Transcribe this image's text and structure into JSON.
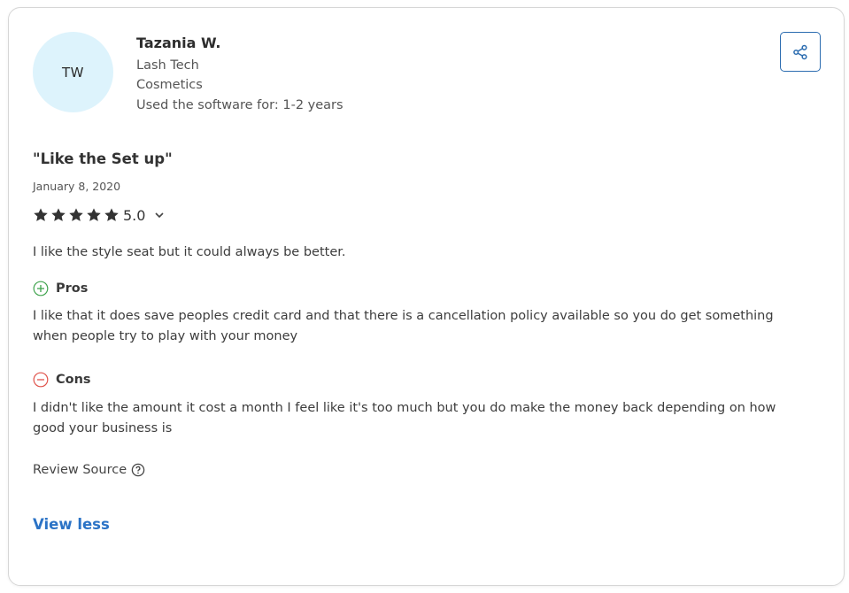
{
  "reviewer": {
    "initials": "TW",
    "name": "Tazania W.",
    "role": "Lash Tech",
    "industry": "Cosmetics",
    "usage": "Used the software for: 1-2 years"
  },
  "review": {
    "title": "\"Like the Set up\"",
    "date": "January 8, 2020",
    "rating": "5.0",
    "stars": 5,
    "summary": "I like the style seat but it could always be better.",
    "pros_label": "Pros",
    "pros_text": "I like that it does save peoples credit card and that there is a cancellation policy available so you do get something when people try to play with your money",
    "cons_label": "Cons",
    "cons_text": "I didn't like the amount it cost a month I feel like it's too much but you do make the money back depending on how good your business is",
    "source_label": "Review Source",
    "view_less": "View less"
  },
  "icons": {
    "share": "share-icon",
    "star": "star-icon",
    "chevron": "chevron-down-icon",
    "pros": "plus-circle-icon",
    "cons": "minus-circle-icon",
    "help": "question-circle-icon"
  },
  "colors": {
    "avatar_bg": "#ddf3fc",
    "accent_blue": "#2b73c6",
    "pros_green": "#3fa34d",
    "cons_red": "#e0524a",
    "star": "#333333"
  }
}
